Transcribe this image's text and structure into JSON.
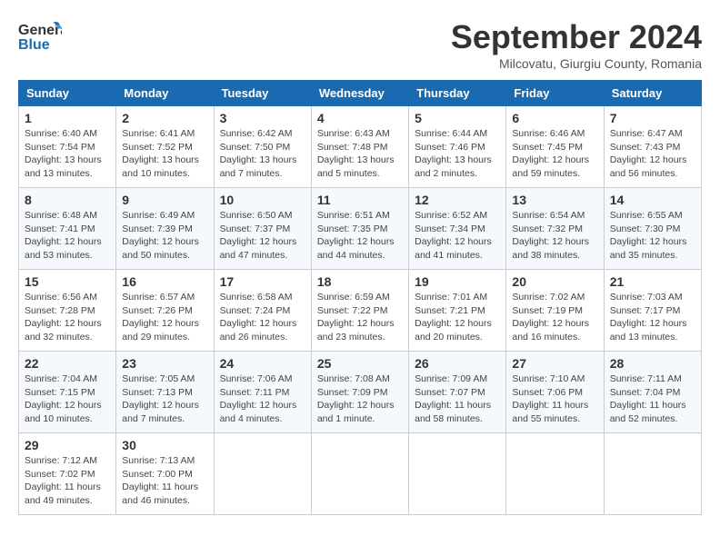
{
  "header": {
    "logo_general": "General",
    "logo_blue": "Blue",
    "month_title": "September 2024",
    "location": "Milcovatu, Giurgiu County, Romania"
  },
  "days_of_week": [
    "Sunday",
    "Monday",
    "Tuesday",
    "Wednesday",
    "Thursday",
    "Friday",
    "Saturday"
  ],
  "weeks": [
    [
      {
        "day": "1",
        "info": "Sunrise: 6:40 AM\nSunset: 7:54 PM\nDaylight: 13 hours and 13 minutes."
      },
      {
        "day": "2",
        "info": "Sunrise: 6:41 AM\nSunset: 7:52 PM\nDaylight: 13 hours and 10 minutes."
      },
      {
        "day": "3",
        "info": "Sunrise: 6:42 AM\nSunset: 7:50 PM\nDaylight: 13 hours and 7 minutes."
      },
      {
        "day": "4",
        "info": "Sunrise: 6:43 AM\nSunset: 7:48 PM\nDaylight: 13 hours and 5 minutes."
      },
      {
        "day": "5",
        "info": "Sunrise: 6:44 AM\nSunset: 7:46 PM\nDaylight: 13 hours and 2 minutes."
      },
      {
        "day": "6",
        "info": "Sunrise: 6:46 AM\nSunset: 7:45 PM\nDaylight: 12 hours and 59 minutes."
      },
      {
        "day": "7",
        "info": "Sunrise: 6:47 AM\nSunset: 7:43 PM\nDaylight: 12 hours and 56 minutes."
      }
    ],
    [
      {
        "day": "8",
        "info": "Sunrise: 6:48 AM\nSunset: 7:41 PM\nDaylight: 12 hours and 53 minutes."
      },
      {
        "day": "9",
        "info": "Sunrise: 6:49 AM\nSunset: 7:39 PM\nDaylight: 12 hours and 50 minutes."
      },
      {
        "day": "10",
        "info": "Sunrise: 6:50 AM\nSunset: 7:37 PM\nDaylight: 12 hours and 47 minutes."
      },
      {
        "day": "11",
        "info": "Sunrise: 6:51 AM\nSunset: 7:35 PM\nDaylight: 12 hours and 44 minutes."
      },
      {
        "day": "12",
        "info": "Sunrise: 6:52 AM\nSunset: 7:34 PM\nDaylight: 12 hours and 41 minutes."
      },
      {
        "day": "13",
        "info": "Sunrise: 6:54 AM\nSunset: 7:32 PM\nDaylight: 12 hours and 38 minutes."
      },
      {
        "day": "14",
        "info": "Sunrise: 6:55 AM\nSunset: 7:30 PM\nDaylight: 12 hours and 35 minutes."
      }
    ],
    [
      {
        "day": "15",
        "info": "Sunrise: 6:56 AM\nSunset: 7:28 PM\nDaylight: 12 hours and 32 minutes."
      },
      {
        "day": "16",
        "info": "Sunrise: 6:57 AM\nSunset: 7:26 PM\nDaylight: 12 hours and 29 minutes."
      },
      {
        "day": "17",
        "info": "Sunrise: 6:58 AM\nSunset: 7:24 PM\nDaylight: 12 hours and 26 minutes."
      },
      {
        "day": "18",
        "info": "Sunrise: 6:59 AM\nSunset: 7:22 PM\nDaylight: 12 hours and 23 minutes."
      },
      {
        "day": "19",
        "info": "Sunrise: 7:01 AM\nSunset: 7:21 PM\nDaylight: 12 hours and 20 minutes."
      },
      {
        "day": "20",
        "info": "Sunrise: 7:02 AM\nSunset: 7:19 PM\nDaylight: 12 hours and 16 minutes."
      },
      {
        "day": "21",
        "info": "Sunrise: 7:03 AM\nSunset: 7:17 PM\nDaylight: 12 hours and 13 minutes."
      }
    ],
    [
      {
        "day": "22",
        "info": "Sunrise: 7:04 AM\nSunset: 7:15 PM\nDaylight: 12 hours and 10 minutes."
      },
      {
        "day": "23",
        "info": "Sunrise: 7:05 AM\nSunset: 7:13 PM\nDaylight: 12 hours and 7 minutes."
      },
      {
        "day": "24",
        "info": "Sunrise: 7:06 AM\nSunset: 7:11 PM\nDaylight: 12 hours and 4 minutes."
      },
      {
        "day": "25",
        "info": "Sunrise: 7:08 AM\nSunset: 7:09 PM\nDaylight: 12 hours and 1 minute."
      },
      {
        "day": "26",
        "info": "Sunrise: 7:09 AM\nSunset: 7:07 PM\nDaylight: 11 hours and 58 minutes."
      },
      {
        "day": "27",
        "info": "Sunrise: 7:10 AM\nSunset: 7:06 PM\nDaylight: 11 hours and 55 minutes."
      },
      {
        "day": "28",
        "info": "Sunrise: 7:11 AM\nSunset: 7:04 PM\nDaylight: 11 hours and 52 minutes."
      }
    ],
    [
      {
        "day": "29",
        "info": "Sunrise: 7:12 AM\nSunset: 7:02 PM\nDaylight: 11 hours and 49 minutes."
      },
      {
        "day": "30",
        "info": "Sunrise: 7:13 AM\nSunset: 7:00 PM\nDaylight: 11 hours and 46 minutes."
      },
      {
        "day": "",
        "info": ""
      },
      {
        "day": "",
        "info": ""
      },
      {
        "day": "",
        "info": ""
      },
      {
        "day": "",
        "info": ""
      },
      {
        "day": "",
        "info": ""
      }
    ]
  ]
}
